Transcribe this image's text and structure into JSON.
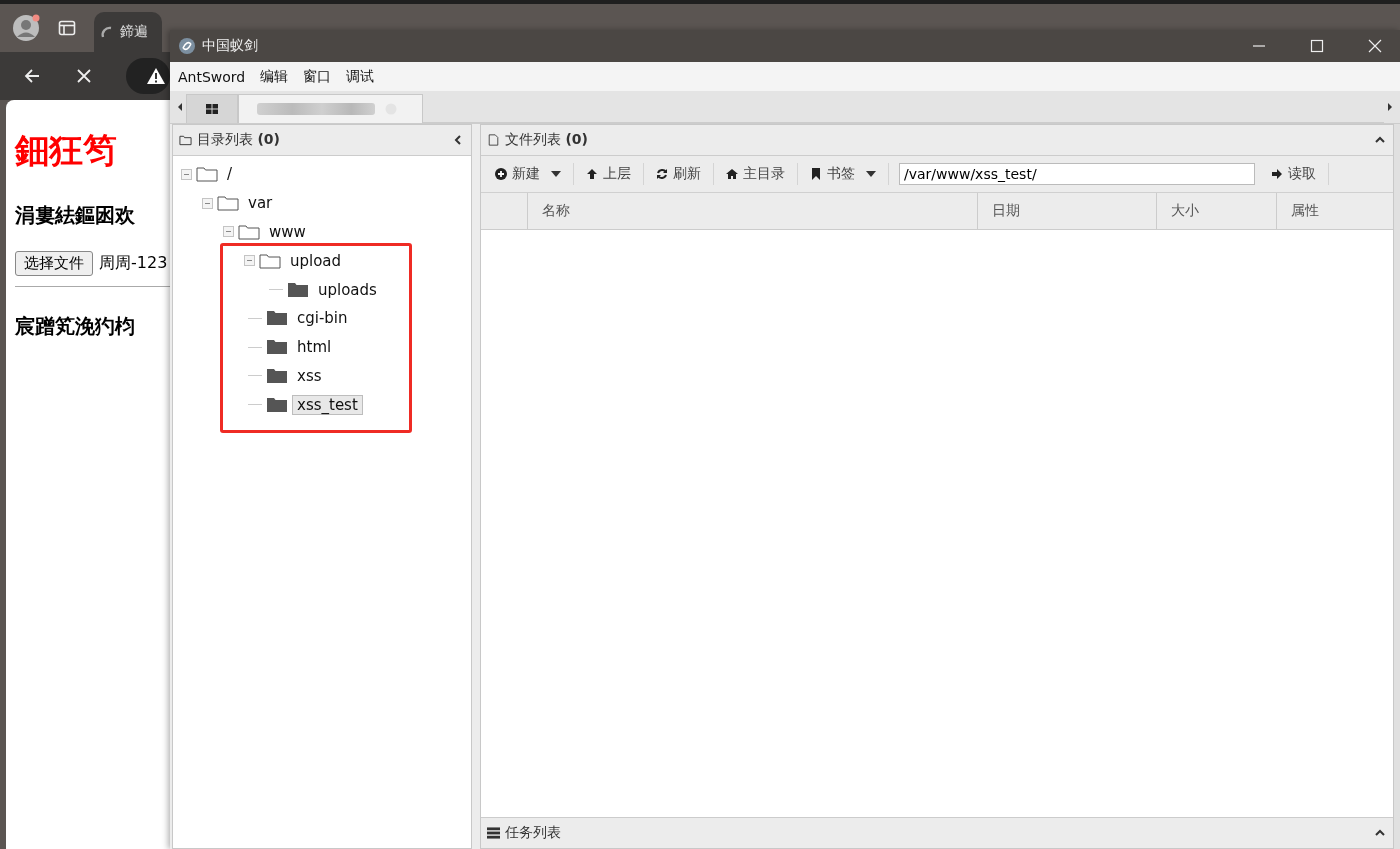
{
  "browser": {
    "tab_title": "鍗遍",
    "page": {
      "heading": "鈿狂笉",
      "subheading": "涓婁紶鏂囦欢",
      "file_button": "选择文件",
      "file_name": "周周-123",
      "section_heading": "宸蹭笂浼犳枃"
    }
  },
  "window": {
    "title": "中国蚁剑"
  },
  "menu": [
    "AntSword",
    "编辑",
    "窗口",
    "调试"
  ],
  "tabs": [
    {
      "kind": "home",
      "selected": false
    },
    {
      "kind": "shell",
      "selected": true
    }
  ],
  "directory_panel": {
    "title": "目录列表",
    "count": "(0)",
    "annotation_frame": true,
    "tree": [
      {
        "name": "/",
        "expanded": true,
        "selected": false,
        "children": [
          {
            "name": "var",
            "expanded": true,
            "selected": false,
            "children": [
              {
                "name": "www",
                "expanded": true,
                "selected": false,
                "children": [
                  {
                    "name": "upload",
                    "expanded": true,
                    "selected": false,
                    "children": [
                      {
                        "name": "uploads",
                        "selected": false
                      }
                    ]
                  },
                  {
                    "name": "cgi-bin",
                    "selected": false
                  },
                  {
                    "name": "html",
                    "selected": false
                  },
                  {
                    "name": "xss",
                    "selected": false
                  },
                  {
                    "name": "xss_test",
                    "selected": true
                  }
                ]
              }
            ]
          }
        ]
      }
    ]
  },
  "file_panel": {
    "title": "文件列表",
    "count": "(0)",
    "toolbar": [
      {
        "kind": "plus",
        "label": "新建",
        "dropdown": true
      },
      {
        "kind": "up",
        "label": "上层",
        "dropdown": false
      },
      {
        "kind": "refresh",
        "label": "刷新",
        "dropdown": false
      },
      {
        "kind": "home",
        "label": "主目录",
        "dropdown": false
      },
      {
        "kind": "bookmark",
        "label": "书签",
        "dropdown": true
      }
    ],
    "path": "/var/www/xss_test/",
    "read_button": "读取",
    "columns": [
      "名称",
      "日期",
      "大小",
      "属性"
    ]
  },
  "task_panel": {
    "title": "任务列表"
  }
}
